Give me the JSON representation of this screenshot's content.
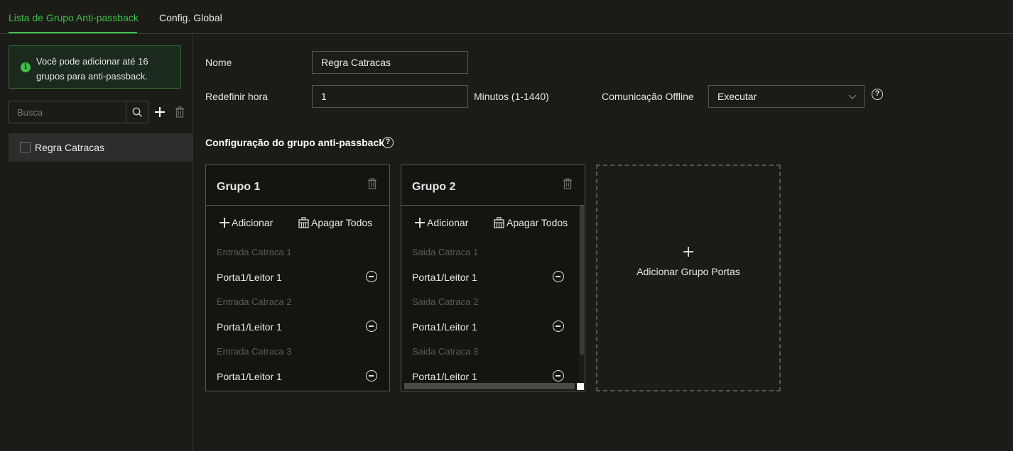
{
  "tabs": [
    {
      "label": "Lista de Grupo Anti-passback",
      "active": true
    },
    {
      "label": "Config. Global",
      "active": false
    }
  ],
  "sidebar": {
    "notice": "Você pode adicionar até 16 grupos para anti-passback.",
    "search_placeholder": "Busca",
    "items": [
      {
        "label": "Regra Catracas",
        "checked": false
      }
    ]
  },
  "form": {
    "name_label": "Nome",
    "name_value": "Regra Catracas",
    "reset_label": "Redefinir hora",
    "reset_value": "1",
    "reset_unit": "Minutos (1-1440)",
    "offline_label": "Comunicação Offline",
    "offline_value": "Executar"
  },
  "section_title": "Configuração do grupo anti-passback",
  "groups": [
    {
      "title": "Grupo 1",
      "add_label": "Adicionar",
      "clear_label": "Apagar Todos",
      "entries": [
        {
          "sub": "Entrada Catraca 1",
          "reader": "Porta1/Leitor 1"
        },
        {
          "sub": "Entrada Catraca 2",
          "reader": "Porta1/Leitor 1"
        },
        {
          "sub": "Entrada Catraca 3",
          "reader": "Porta1/Leitor 1"
        }
      ]
    },
    {
      "title": "Grupo 2",
      "add_label": "Adicionar",
      "clear_label": "Apagar Todos",
      "entries": [
        {
          "sub": "Saida Catraca 1",
          "reader": "Porta1/Leitor 1"
        },
        {
          "sub": "Saida Catraca 2",
          "reader": "Porta1/Leitor 1"
        },
        {
          "sub": "Saida Catraca 3",
          "reader": "Porta1/Leitor 1"
        }
      ]
    }
  ],
  "add_group_label": "Adicionar Grupo Portas",
  "colors": {
    "accent": "#3fbf4a",
    "background": "#1b1c17",
    "border": "#55564f"
  },
  "icons": [
    "info-icon",
    "search-icon",
    "plus-icon",
    "trash-icon",
    "help-icon",
    "chevron-down-icon",
    "remove-icon",
    "clear-all-icon"
  ]
}
